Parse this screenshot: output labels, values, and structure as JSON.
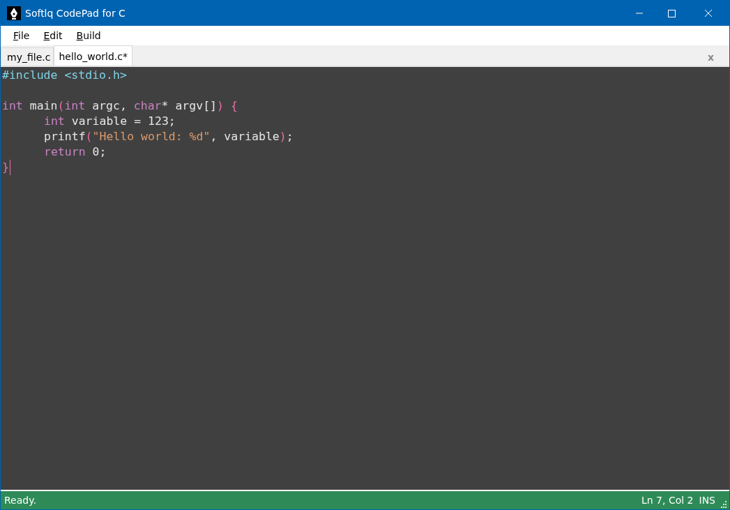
{
  "window": {
    "title": "Softlq CodePad for C"
  },
  "menu": [
    "File",
    "Edit",
    "Build"
  ],
  "tabs": [
    {
      "label": "my_file.c",
      "selected": false
    },
    {
      "label": "hello_world.c*",
      "selected": true
    }
  ],
  "tab_close": "x",
  "editor": {
    "lines": [
      {
        "kind": "code",
        "indented": false,
        "cursor": false,
        "tokens": [
          {
            "kind": "preproc",
            "text": "#include <stdio.h>"
          }
        ]
      },
      {
        "kind": "blank"
      },
      {
        "kind": "code",
        "indented": false,
        "cursor": false,
        "tokens": [
          {
            "kind": "keyword",
            "text": "int"
          },
          {
            "kind": "plain",
            "text": " main"
          },
          {
            "kind": "paren",
            "text": "("
          },
          {
            "kind": "keyword",
            "text": "int"
          },
          {
            "kind": "plain",
            "text": " argc, "
          },
          {
            "kind": "keyword",
            "text": "char"
          },
          {
            "kind": "plain",
            "text": "* argv[]"
          },
          {
            "kind": "paren",
            "text": ") {"
          }
        ]
      },
      {
        "kind": "code",
        "indented": true,
        "cursor": false,
        "tokens": [
          {
            "kind": "keyword",
            "text": "int"
          },
          {
            "kind": "plain",
            "text": " variable = 123;"
          }
        ]
      },
      {
        "kind": "code",
        "indented": true,
        "cursor": false,
        "tokens": [
          {
            "kind": "plain",
            "text": "printf"
          },
          {
            "kind": "paren",
            "text": "("
          },
          {
            "kind": "string",
            "text": "\"Hello world: %d\""
          },
          {
            "kind": "plain",
            "text": ", variable"
          },
          {
            "kind": "paren",
            "text": ")"
          },
          {
            "kind": "plain",
            "text": ";"
          }
        ]
      },
      {
        "kind": "code",
        "indented": true,
        "cursor": false,
        "tokens": [
          {
            "kind": "keyword",
            "text": "return"
          },
          {
            "kind": "plain",
            "text": " 0;"
          }
        ]
      },
      {
        "kind": "code",
        "indented": false,
        "cursor": true,
        "tokens": [
          {
            "kind": "paren",
            "text": "}"
          }
        ]
      }
    ]
  },
  "status_bar": {
    "message": "Ready.",
    "position": "Ln 7, Col 2",
    "mode": "INS"
  }
}
